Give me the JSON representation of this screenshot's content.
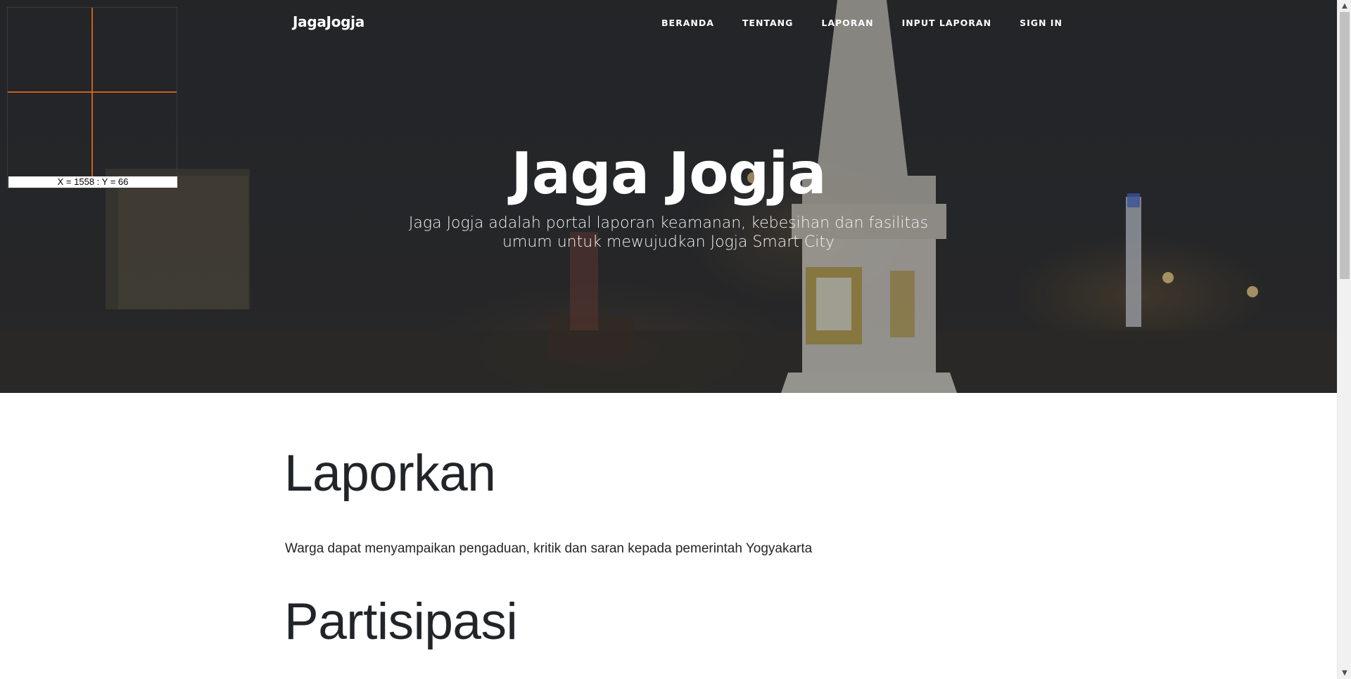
{
  "brand": "JagaJogja",
  "nav": {
    "items": [
      "BERANDA",
      "TENTANG",
      "LAPORAN",
      "INPUT LAPORAN",
      "SIGN IN"
    ]
  },
  "hero": {
    "title": "Jaga Jogja",
    "subtitle": "Jaga Jogja adalah portal laporan keamanan, kebesihan dan fasilitas umum untuk mewujudkan Jogja Smart City"
  },
  "coord_widget": {
    "readout": "X = 1558 : Y = 66"
  },
  "sections": [
    {
      "title": "Laporkan",
      "text": "Warga dapat menyampaikan pengaduan, kritik dan saran kepada pemerintah Yogyakarta"
    },
    {
      "title": "Partisipasi"
    }
  ],
  "colors": {
    "hero_overlay": "#212529",
    "text_dark": "#212529",
    "crosshair": "#c8601a"
  },
  "icons": {
    "scroll_up": "scroll-up-arrow-icon",
    "scroll_down": "scroll-down-arrow-icon"
  }
}
